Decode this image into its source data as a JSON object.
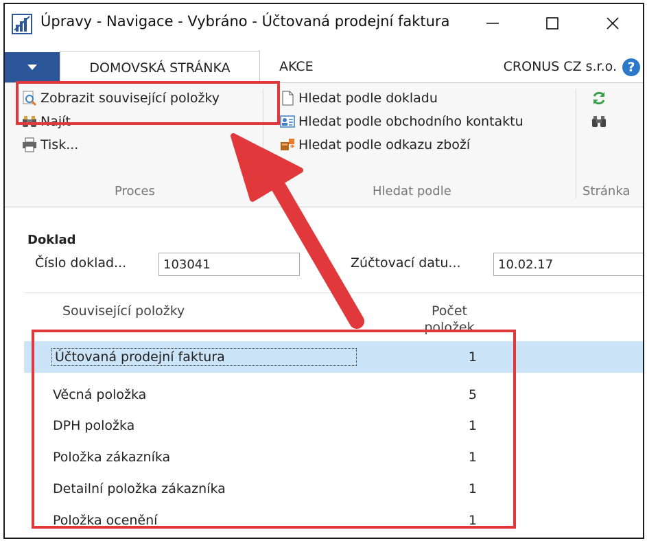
{
  "window": {
    "title": "Úpravy - Navigace - Vybráno - Účtovaná prodejní faktura",
    "minimize_label": "—",
    "maximize_label": "☐",
    "close_label": "✕"
  },
  "ribbon": {
    "tabs": [
      {
        "label": "DOMOVSKÁ STRÁNKA",
        "active": true
      },
      {
        "label": "AKCE",
        "active": false
      }
    ],
    "company": "CRONUS CZ s.r.o.",
    "help_label": "?",
    "groups": {
      "proces": {
        "label": "Proces",
        "items": [
          "Zobrazit související položky",
          "Najít",
          "Tisk..."
        ]
      },
      "hledat": {
        "label": "Hledat podle",
        "items": [
          "Hledat podle dokladu",
          "Hledat podle obchodního kontaktu",
          "Hledat podle odkazu zboží"
        ]
      },
      "stranka": {
        "label": "Stránka"
      }
    }
  },
  "doklad": {
    "section_title": "Doklad",
    "cislo_label": "Číslo doklad...",
    "cislo_value": "103041",
    "datum_label": "Zúčtovací datu...",
    "datum_value": "10.02.17"
  },
  "table": {
    "col_name": "Související položky",
    "col_count": "Počet položek",
    "rows": [
      {
        "name": "Účtovaná prodejní faktura",
        "count": "1"
      },
      {
        "name": "Věcná položka",
        "count": "5"
      },
      {
        "name": "DPH položka",
        "count": "1"
      },
      {
        "name": "Položka zákazníka",
        "count": "1"
      },
      {
        "name": "Detailní položka zákazníka",
        "count": "1"
      },
      {
        "name": "Položka ocenění",
        "count": "1"
      }
    ]
  },
  "colors": {
    "accent": "#2b579a",
    "highlight": "#e0383b",
    "selected_row": "#cce4f7"
  }
}
